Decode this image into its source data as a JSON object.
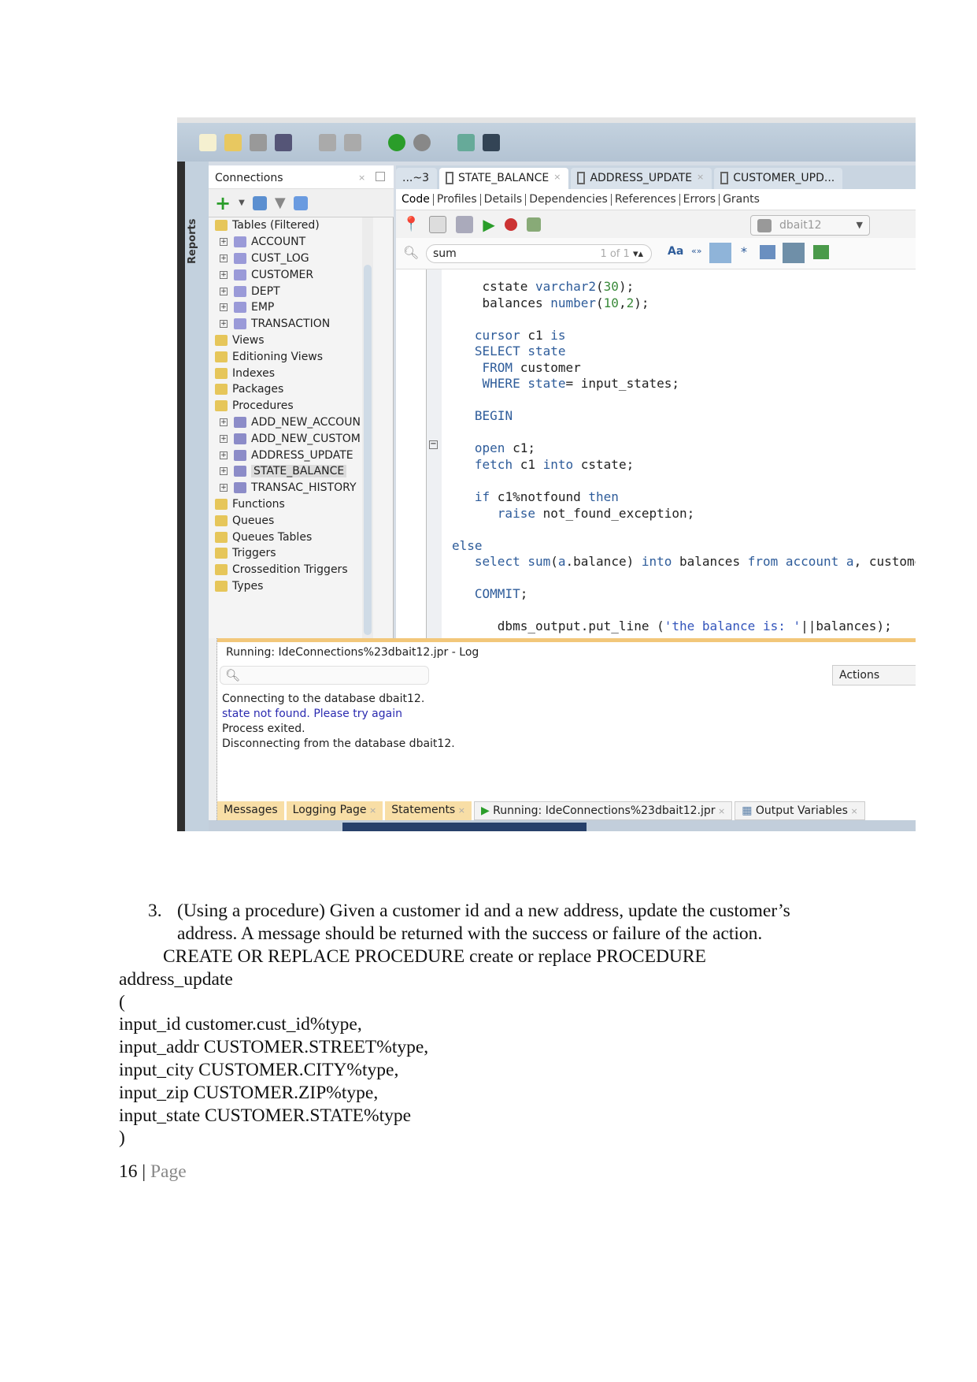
{
  "ide": {
    "toolbar_icons": [
      "new-file-icon",
      "open-folder-icon",
      "save-icon",
      "save-all-icon",
      "undo-icon",
      "redo-icon",
      "back-icon",
      "forward-icon",
      "sql-worksheet-icon",
      "binoculars-icon"
    ],
    "reports_label": "Reports",
    "connections": {
      "title": "Connections",
      "tree": [
        {
          "label": "Tables (Filtered)",
          "level": 0,
          "icon": "folder-table-icon"
        },
        {
          "label": "ACCOUNT",
          "level": 1,
          "icon": "table-icon"
        },
        {
          "label": "CUST_LOG",
          "level": 1,
          "icon": "table-icon"
        },
        {
          "label": "CUSTOMER",
          "level": 1,
          "icon": "table-icon"
        },
        {
          "label": "DEPT",
          "level": 1,
          "icon": "table-icon"
        },
        {
          "label": "EMP",
          "level": 1,
          "icon": "table-icon"
        },
        {
          "label": "TRANSACTION",
          "level": 1,
          "icon": "table-icon"
        },
        {
          "label": "Views",
          "level": 0,
          "icon": "folder-views-icon"
        },
        {
          "label": "Editioning Views",
          "level": 0,
          "icon": "folder-views-icon"
        },
        {
          "label": "Indexes",
          "level": 0,
          "icon": "folder-indexes-icon"
        },
        {
          "label": "Packages",
          "level": 0,
          "icon": "folder-packages-icon"
        },
        {
          "label": "Procedures",
          "level": 0,
          "icon": "folder-procedures-icon"
        },
        {
          "label": "ADD_NEW_ACCOUN",
          "level": 1,
          "icon": "procedure-icon"
        },
        {
          "label": "ADD_NEW_CUSTOM",
          "level": 1,
          "icon": "procedure-icon"
        },
        {
          "label": "ADDRESS_UPDATE",
          "level": 1,
          "icon": "procedure-icon"
        },
        {
          "label": "STATE_BALANCE",
          "level": 1,
          "icon": "procedure-icon",
          "selected": true
        },
        {
          "label": "TRANSAC_HISTORY",
          "level": 1,
          "icon": "procedure-icon"
        },
        {
          "label": "Functions",
          "level": 0,
          "icon": "folder-functions-icon"
        },
        {
          "label": "Queues",
          "level": 0,
          "icon": "folder-queues-icon"
        },
        {
          "label": "Queues Tables",
          "level": 0,
          "icon": "folder-queues-icon"
        },
        {
          "label": "Triggers",
          "level": 0,
          "icon": "folder-triggers-icon"
        },
        {
          "label": "Crossedition Triggers",
          "level": 0,
          "icon": "folder-triggers-icon"
        },
        {
          "label": "Types",
          "level": 0,
          "icon": "folder-types-icon"
        }
      ]
    },
    "editor": {
      "tabs": [
        {
          "label": "...~3"
        },
        {
          "label": "STATE_BALANCE",
          "active": true
        },
        {
          "label": "ADDRESS_UPDATE"
        },
        {
          "label": "CUSTOMER_UPD..."
        }
      ],
      "subtabs": [
        "Code",
        "Profiles",
        "Details",
        "Dependencies",
        "References",
        "Errors",
        "Grants"
      ],
      "connection": "dbait12",
      "search_value": "sum",
      "search_count": "1 of 1",
      "code": [
        {
          "indent": 4,
          "tokens": [
            [
              "cstate ",
              ""
            ],
            [
              "varchar2",
              "kw"
            ],
            [
              "(",
              ""
            ],
            [
              "30",
              "num"
            ],
            [
              ");",
              ""
            ]
          ]
        },
        {
          "indent": 4,
          "tokens": [
            [
              "balances ",
              ""
            ],
            [
              "number",
              "kw"
            ],
            [
              "(",
              ""
            ],
            [
              "10",
              "num"
            ],
            [
              ",",
              ""
            ],
            [
              "2",
              "num"
            ],
            [
              ");",
              ""
            ]
          ]
        },
        null,
        {
          "indent": 3,
          "tokens": [
            [
              "cursor",
              "kw"
            ],
            [
              " c1 ",
              ""
            ],
            [
              "is",
              "kw"
            ]
          ]
        },
        {
          "indent": 3,
          "tokens": [
            [
              "SELECT state",
              "kw"
            ]
          ]
        },
        {
          "indent": 4,
          "tokens": [
            [
              "FROM",
              "kw"
            ],
            [
              " customer",
              ""
            ]
          ]
        },
        {
          "indent": 4,
          "tokens": [
            [
              "WHERE state",
              "kw"
            ],
            [
              "= input_states;",
              ""
            ]
          ]
        },
        null,
        {
          "indent": 3,
          "tokens": [
            [
              "BEGIN",
              "kw"
            ]
          ]
        },
        null,
        {
          "indent": 3,
          "tokens": [
            [
              "open",
              "kw"
            ],
            [
              " c1;",
              ""
            ]
          ]
        },
        {
          "indent": 3,
          "tokens": [
            [
              "fetch",
              "kw"
            ],
            [
              " c1 ",
              ""
            ],
            [
              "into",
              "kw"
            ],
            [
              " cstate;",
              ""
            ]
          ]
        },
        null,
        {
          "indent": 3,
          "tokens": [
            [
              "if",
              "kw"
            ],
            [
              " c1%notfound ",
              ""
            ],
            [
              "then",
              "kw"
            ]
          ]
        },
        {
          "indent": 6,
          "tokens": [
            [
              "raise",
              "kw"
            ],
            [
              " not_found_exception;",
              ""
            ]
          ]
        },
        null,
        {
          "indent": 0,
          "tokens": [
            [
              "else",
              "kw"
            ]
          ]
        },
        {
          "indent": 3,
          "tokens": [
            [
              "select sum",
              "kw"
            ],
            [
              "(",
              ""
            ],
            [
              "a",
              "kw"
            ],
            [
              ".balance) ",
              ""
            ],
            [
              "into",
              "kw"
            ],
            [
              " balances ",
              ""
            ],
            [
              "from account a",
              "kw"
            ],
            [
              ", customer",
              ""
            ]
          ]
        },
        null,
        {
          "indent": 3,
          "tokens": [
            [
              "COMMIT",
              "kw"
            ],
            [
              ";",
              ""
            ]
          ]
        },
        null,
        {
          "indent": 6,
          "tokens": [
            [
              "dbms_output.put_line (",
              ""
            ],
            [
              "'the balance is: '",
              "str"
            ],
            [
              "||balances);",
              ""
            ]
          ]
        }
      ]
    },
    "log": {
      "title": "Running: IdeConnections%23dbait12.jpr - Log",
      "actions_label": "Actions",
      "lines": [
        {
          "text": "Connecting to the database dbait12.",
          "color": "#222222"
        },
        {
          "text": "state not found. Please try again",
          "color": "#2b2bb0"
        },
        {
          "text": "Process exited.",
          "color": "#222222"
        },
        {
          "text": "Disconnecting from the database dbait12.",
          "color": "#222222"
        }
      ],
      "bottom_tabs": [
        "Messages",
        "Logging Page",
        "Statements",
        "Running: IdeConnections%23dbait12.jpr",
        "Output Variables"
      ]
    }
  },
  "document": {
    "item_number": "3.",
    "question_line1": "(Using a procedure) Given a customer id and a new address, update the customer’s",
    "question_line2": "address.  A message should be returned with the success or failure of the action.",
    "code_lines": [
      "CREATE OR REPLACE PROCEDURE create or replace PROCEDURE",
      "address_update",
      "(",
      "input_id customer.cust_id%type,",
      "input_addr CUSTOMER.STREET%type,",
      "input_city CUSTOMER.CITY%type,",
      "input_zip CUSTOMER.ZIP%type,",
      "input_state CUSTOMER.STATE%type",
      ")"
    ],
    "page_number": "16",
    "page_separator": "|",
    "page_word": "Page"
  }
}
